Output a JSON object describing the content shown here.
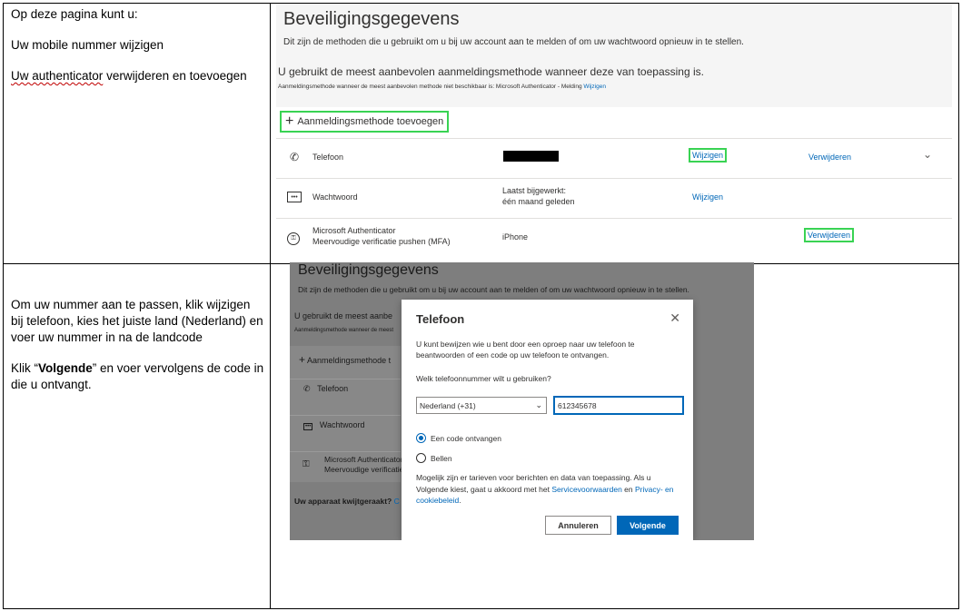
{
  "row1": {
    "intro": "Op deze pagina kunt u:",
    "line1": "Uw mobile nummer wijzigen",
    "line2_word": "Uw authenticator",
    "line2_rest": " verwijderen en toevoegen"
  },
  "row2": {
    "instr": "Om uw nummer aan te passen, klik wijzigen bij telefoon, kies het juiste land (Nederland) en voer uw nummer in na de landcode",
    "klik_pre": "Klik “",
    "klik_bold": "Volgende",
    "klik_post": "” en voer vervolgens de code in die u ontvangt."
  },
  "shot1": {
    "title": "Beveiligingsgegevens",
    "desc": "Dit zijn de methoden die u gebruikt om u bij uw account aan te melden of om uw wachtwoord opnieuw in te stellen.",
    "recommend": "U gebruikt de meest aanbevolen aanmeldingsmethode wanneer deze van toepassing is.",
    "sub": "Aanmeldingsmethode wanneer de meest aanbevolen methode niet beschikbaar is: Microsoft Authenticator - Melding",
    "sub_link": "Wijzigen",
    "add": "Aanmeldingsmethode toevoegen",
    "rows": [
      {
        "name": "Telefoon",
        "change": "Wijzigen",
        "remove": "Verwijderen"
      },
      {
        "name": "Wachtwoord",
        "val1": "Laatst bijgewerkt:",
        "val2": "één maand geleden",
        "change": "Wijzigen"
      },
      {
        "name1": "Microsoft Authenticator",
        "name2": "Meervoudige verificatie pushen (MFA)",
        "val": "iPhone",
        "remove": "Verwijderen"
      }
    ]
  },
  "shot2": {
    "title": "Beveiligingsgegevens",
    "desc": "Dit zijn de methoden die u gebruikt om u bij uw account aan te melden of om uw wachtwoord opnieuw in te stellen.",
    "bg_recommend": "U gebruikt de meest aanbe",
    "bg_small": "Aanmeldingsmethode wanneer de meest",
    "bg_add": "Aanmeldingsmethode t",
    "bg_phone": "Telefoon",
    "bg_password": "Wachtwoord",
    "bg_auth1": "Microsoft Authenticator",
    "bg_auth2": "Meervoudige verificatie",
    "bg_lost": "Uw apparaat kwijtgeraakt?",
    "bg_lost_link": "C",
    "dialog": {
      "title": "Telefoon",
      "text": "U kunt bewijzen wie u bent door een oproep naar uw telefoon te beantwoorden of een code op uw telefoon te ontvangen.",
      "question": "Welk telefoonnummer wilt u gebruiken?",
      "country": "Nederland (+31)",
      "phone": "612345678",
      "option1": "Een code ontvangen",
      "option2": "Bellen",
      "note_pre": "Mogelijk zijn er tarieven voor berichten en data van toepassing. Als u Volgende kiest, gaat u akkoord met het ",
      "link1": "Servicevoorwaarden",
      "note_mid": " en ",
      "link2": "Privacy- en cookiebeleid",
      "note_end": ".",
      "cancel": "Annuleren",
      "next": "Volgende"
    }
  }
}
